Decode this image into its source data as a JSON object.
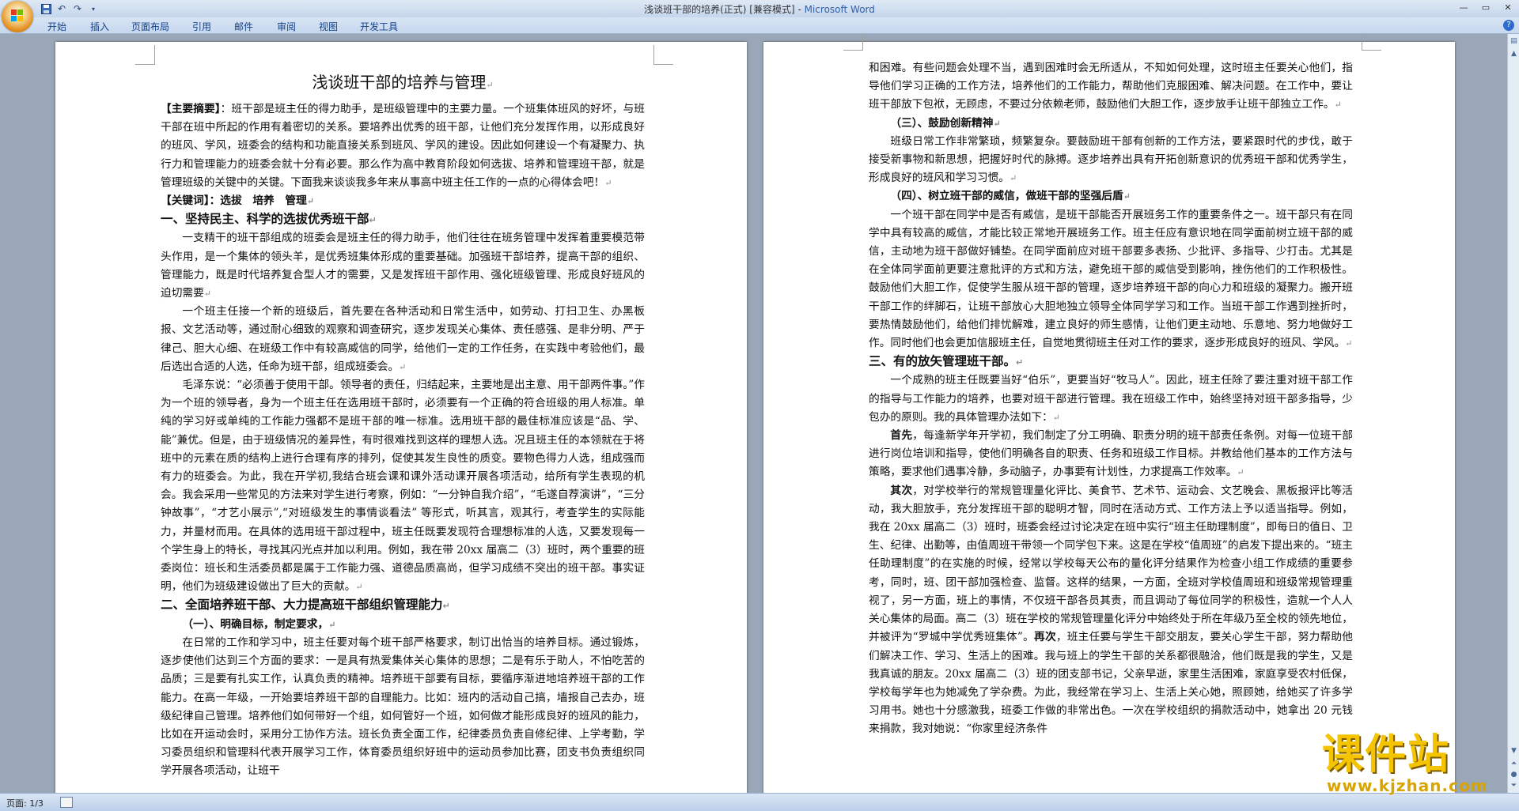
{
  "window": {
    "title": "浅谈班干部的培养(正式) [兼容模式] - ",
    "app_name": "Microsoft Word",
    "accent": "#3060a8"
  },
  "quick_access": {
    "icons": [
      "save-icon",
      "undo-icon",
      "redo-icon",
      "customize-icon"
    ]
  },
  "ribbon": {
    "tabs": [
      "开始",
      "插入",
      "页面布局",
      "引用",
      "邮件",
      "审阅",
      "视图",
      "开发工具"
    ]
  },
  "status": {
    "page": "页面: 1/3"
  },
  "watermark": {
    "text": "课件站",
    "url": "www.kjzhan.com"
  },
  "page1": {
    "title": "浅谈班干部的培养与管理",
    "abstract_label": "【主要摘要】",
    "abstract": "：班干部是班主任的得力助手，是班级管理中的主要力量。一个班集体班风的好坏，与班干部在班中所起的作用有着密切的关系。要培养出优秀的班干部，让他们充分发挥作用，以形成良好的班风、学风，班委会的结构和功能直接关系到班风、学风的建设。因此如何建设一个有凝聚力、执行力和管理能力的班委会就十分有必要。那么作为高中教育阶段如何选拔、培养和管理班干部，就是管理班级的关键中的关键。下面我来谈谈我多年来从事高中班主任工作的一点的心得体会吧！",
    "keywords": "【关键词】：选拔　培养　管理",
    "h_one": "一、坚持民主、科学的选拔优秀班干部",
    "p1": "一支精干的班干部组成的班委会是班主任的得力助手，他们往往在班务管理中发挥着重要模范带头作用，是一个集体的领头羊，是优秀班集体形成的重要基础。加强班干部培养，提高干部的组织、管理能力，既是时代培养复合型人才的需要，又是发挥班干部作用、强化班级管理、形成良好班风的迫切需要",
    "p2": "一个班主任接一个新的班级后，首先要在各种活动和日常生活中，如劳动、打扫卫生、办黑板报、文艺活动等，通过耐心细致的观察和调查研究，逐步发现关心集体、责任感强、是非分明、严于律己、胆大心细、在班级工作中有较高威信的同学，给他们一定的工作任务，在实践中考验他们，最后选出合适的人选，任命为班干部，组成班委会。",
    "p3": "毛泽东说：“必须善于使用干部。领导者的责任，归结起来，主要地是出主意、用干部两件事。”作为一个班的领导者，身为一个班主任在选用班干部时，必须要有一个正确的符合班级的用人标准。单纯的学习好或单纯的工作能力强都不是班干部的唯一标准。选用班干部的最佳标准应该是“品、学、能”兼优。但是，由于班级情况的差异性，有时很难找到这样的理想人选。况且班主任的本领就在于将班中的元素在质的结构上进行合理有序的排列，促使其发生良性的质变。要物色得力人选，组成强而有力的班委会。为此，我在开学初,我结合班会课和课外活动课开展各项活动，给所有学生表现的机会。我会采用一些常见的方法来对学生进行考察，例如：“一分钟自我介绍”，“毛遂自荐演讲”，“三分钟故事”，“才艺小展示”,“对班级发生的事情谈看法” 等形式，听其言，观其行，考查学生的实际能力，并量材而用。在具体的选用班干部过程中，班主任既要发现符合理想标准的人选，又要发现每一个学生身上的特长，寻找其闪光点并加以利用。例如，我在带 20xx 届高二（3）班时，两个重要的班委岗位：班长和生活委员都是属于工作能力强、道德品质高尚，但学习成绩不突出的班干部。事实证明，他们为班级建设做出了巨大的贡献。",
    "h_two": "二、全面培养班干部、大力提高班干部组织管理能力",
    "h_two_1": "（一）、明确目标，制定要求，",
    "p4": "在日常的工作和学习中，班主任要对每个班干部严格要求，制订出恰当的培养目标。通过锻炼，逐步使他们达到三个方面的要求：一是具有热爱集体关心集体的思想；二是有乐于助人，不怕吃苦的品质；三是要有扎实工作，认真负责的精神。培养班干部要有目标，要循序渐进地培养班干部的工作能力。在高一年级，一开始要培养班干部的自理能力。比如：班内的活动自己搞，墙报自己去办，班级纪律自己管理。培养他们如何带好一个组，如何管好一个班，如何做才能形成良好的班风的能力，比如在开运动会时，采用分工协作方法。班长负责全面工作，纪律委员负责自修纪律、上学考勤，学习委员组织和管理科代表开展学习工作，体育委员组织好班中的运动员参加比赛，团支书负责组织同学开展各项活动，让班干"
  },
  "page2": {
    "p0": "和困难。有些问题会处理不当，遇到困难时会无所适从，不知如何处理，这时班主任要关心他们，指导他们学习正确的工作方法，培养他们的工作能力，帮助他们克服困难、解决问题。在工作中，要让班干部放下包袱，无顾虑，不要过分依赖老师，鼓励他们大胆工作，逐步放手让班干部独立工作。",
    "h_three": "（三）、鼓励创新精神",
    "p1": "班级日常工作非常繁琐，频繁复杂。要鼓励班干部有创新的工作方法，要紧跟时代的步伐，敢于接受新事物和新思想，把握好时代的脉搏。逐步培养出具有开拓创新意识的优秀班干部和优秀学生，形成良好的班风和学习习惯。",
    "h_four": "（四）、树立班干部的威信，做班干部的坚强后盾",
    "p2": "一个班干部在同学中是否有威信，是班干部能否开展班务工作的重要条件之一。班干部只有在同学中具有较高的威信，才能比较正常地开展班务工作。班主任应有意识地在同学面前树立班干部的威信，主动地为班干部做好铺垫。在同学面前应对班干部要多表扬、少批评、多指导、少打击。尤其是在全体同学面前更要注意批评的方式和方法，避免班干部的威信受到影响，挫伤他们的工作积极性。鼓励他们大胆工作，促使学生服从班干部的管理，逐步培养班干部的向心力和班级的凝聚力。搬开班干部工作的绊脚石，让班干部放心大胆地独立领导全体同学学习和工作。当班干部工作遇到挫折时，要热情鼓励他们，给他们排忧解难，建立良好的师生感情，让他们更主动地、乐意地、努力地做好工作。同时他们也会更加信服班主任，自觉地贯彻班主任对工作的要求，逐步形成良好的班风、学风。",
    "h_three_main": "三、有的放矢管理班干部。",
    "p3": "一个成熟的班主任既要当好“伯乐”，更要当好“牧马人”。因此，班主任除了要注重对班干部工作的指导与工作能力的培养，也要对班干部进行管理。我在班级工作中，始终坚持对班干部多指导，少包办的原则。我的具体管理办法如下：",
    "first_label": "首先",
    "p4": "，每逢新学年开学初，我们制定了分工明确、职责分明的班干部责任条例。对每一位班干部进行岗位培训和指导，使他们明确各自的职责、任务和班级工作目标。并教给他们基本的工作方法与策略，要求他们遇事冷静，多动脑子，办事要有计划性，力求提高工作效率。",
    "second_label": "其次",
    "p5a": "，对学校举行的常规管理量化评比、美食节、艺术节、运动会、文艺晚会、黑板报评比等活动，我大胆放手，充分发挥班干部的聪明才智，同时在活动方式、工作方法上予以适当指导。例如，我在 20xx 届高二（3）班时，班委会经过讨论决定在班中实行“班主任助理制度”，即每日的值日、卫生、纪律、出勤等，由值周班干带领一个同学包下来。这是在学校“值周班”的启发下提出来的。“班主任助理制度”的在实施的时候，经常以学校每天公布的量化评分结果作为检查小组工作成绩的重要参考，同时，班、团干部加强检查、监督。这样的结果，一方面，全班对学校值周班和班级常规管理重视了，另一方面，班上的事情，不仅班干部各员其责，而且调动了每位同学的积极性，造就一个人人关心集体的局面。高二（3）班在学校的常规管理量化评分中始终处于所在年级乃至全校的领先地位，并被评为“罗城中学优秀班集体”。",
    "third_label": "再次",
    "p5b": "，班主任要与学生干部交朋友，要关心学生干部，努力帮助他们解决工作、学习、生活上的困难。我与班上的学生干部的关系都很融洽，他们既是我的学生，又是我真诚的朋友。20xx 届高二（3）班的团支部书记，父亲早逝，家里生活困难，家庭享受农村低保，学校每学年也为她减免了学杂费。为此，我经常在学习上、生活上关心她，照顾她，给她买了许多学习用书。她也十分感激我，班委工作做的非常出色。一次在学校组织的捐款活动中，她拿出 20 元钱来捐款，我对她说：“你家里经济条件"
  }
}
